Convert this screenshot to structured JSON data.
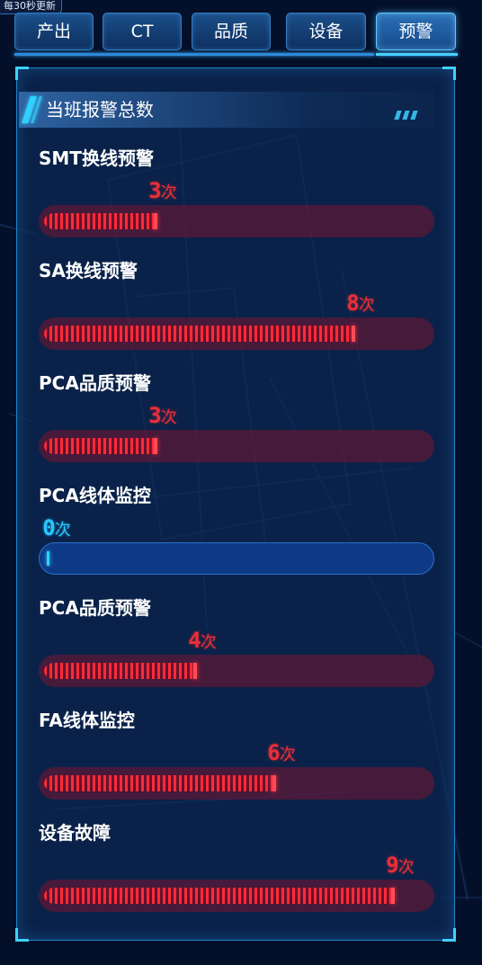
{
  "refresh_note": "每30秒更新",
  "tabs": [
    {
      "label": "产出",
      "active": false
    },
    {
      "label": "CT",
      "active": false
    },
    {
      "label": "品质",
      "active": false
    },
    {
      "label": "设备",
      "active": false
    },
    {
      "label": "预警",
      "active": true
    }
  ],
  "panel": {
    "title": "当班报警总数",
    "unit": "次",
    "max_count": 10,
    "metrics": [
      {
        "label": "SMT换线预警",
        "count": 3
      },
      {
        "label": "SA换线预警",
        "count": 8
      },
      {
        "label": "PCA品质预警",
        "count": 3
      },
      {
        "label": "PCA线体监控",
        "count": 0
      },
      {
        "label": "PCA品质预警",
        "count": 4
      },
      {
        "label": "FA线体监控",
        "count": 6
      },
      {
        "label": "设备故障",
        "count": 9
      }
    ]
  },
  "colors": {
    "alarm_red": "#e8303a",
    "zero_cyan": "#29c8ff",
    "tab_active": "#2b6fb6",
    "panel_border": "#1f86c9"
  }
}
